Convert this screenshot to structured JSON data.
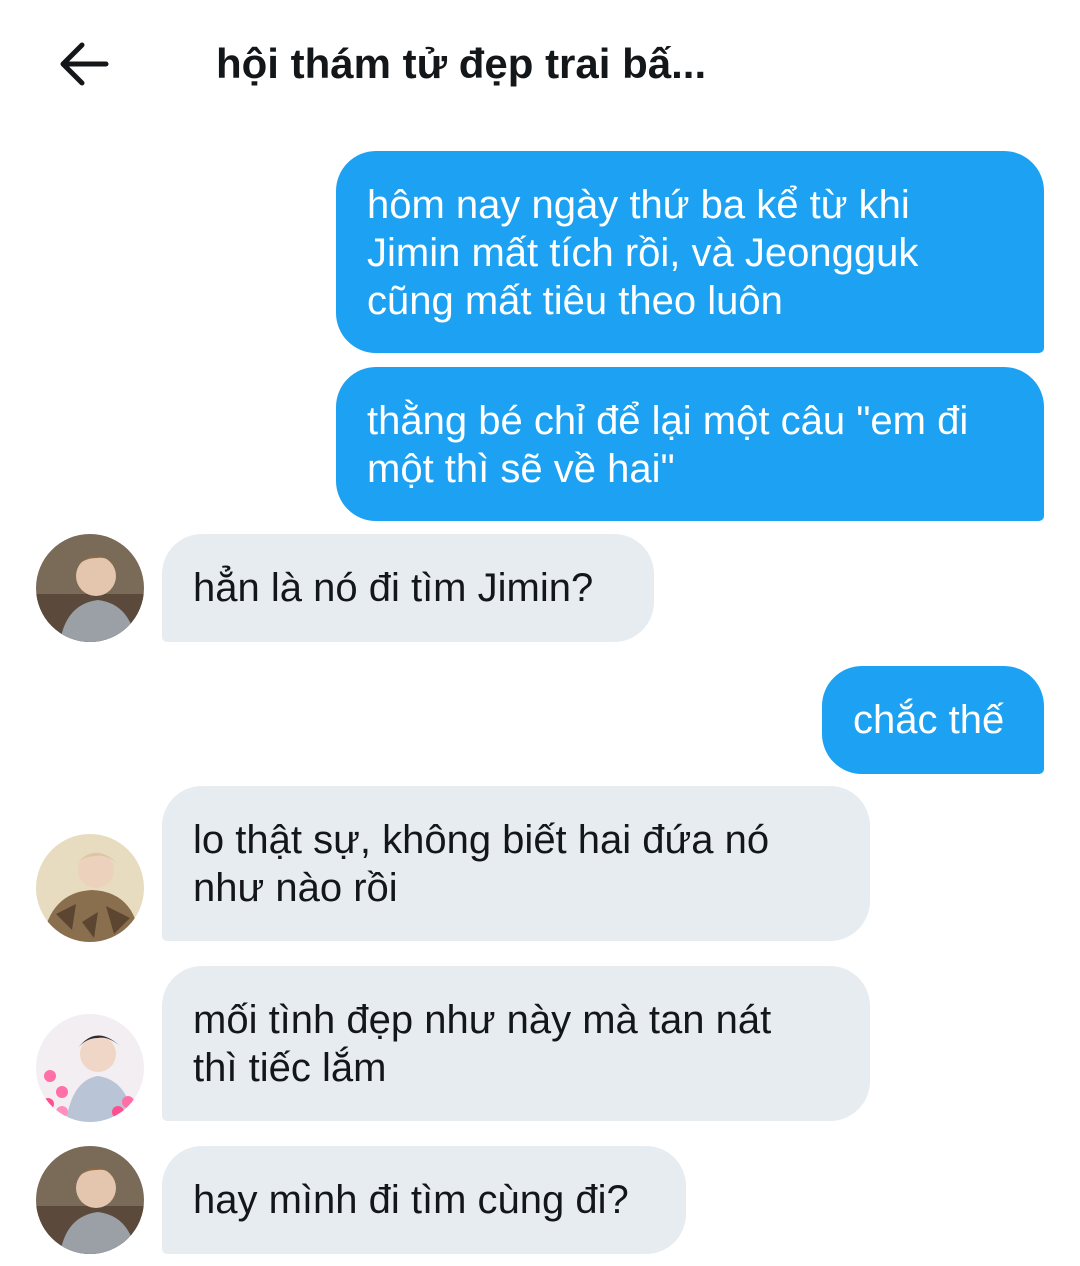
{
  "header": {
    "back_icon": "arrow-left-icon",
    "title": "hội thám tử đẹp trai bấ..."
  },
  "messages": [
    {
      "direction": "outgoing",
      "text": "hôm nay ngày thứ ba kể từ khi\nJimin mất tích rồi, và Jeongguk\ncũng mất tiêu theo luôn"
    },
    {
      "direction": "outgoing",
      "text": "thằng bé chỉ để lại một câu \"em đi\nmột thì sẽ về hai\""
    },
    {
      "direction": "incoming",
      "avatar": "avatar-photo",
      "text": "hẳn là nó đi tìm Jimin?"
    },
    {
      "direction": "outgoing",
      "text": "chắc thế"
    },
    {
      "direction": "incoming",
      "avatar": "avatar-photo",
      "text": "lo thật sự, không biết hai đứa nó\nnhư nào rồi"
    },
    {
      "direction": "incoming",
      "avatar": "avatar-photo",
      "text": "mối tình đẹp như này mà tan nát\nthì tiếc lắm"
    },
    {
      "direction": "incoming",
      "avatar": "avatar-photo",
      "text": "hay mình đi tìm cùng đi?"
    }
  ],
  "colors": {
    "outgoing_bubble": "#1da1f2",
    "incoming_bubble": "#e6ecf0",
    "text_dark": "#14171a"
  }
}
